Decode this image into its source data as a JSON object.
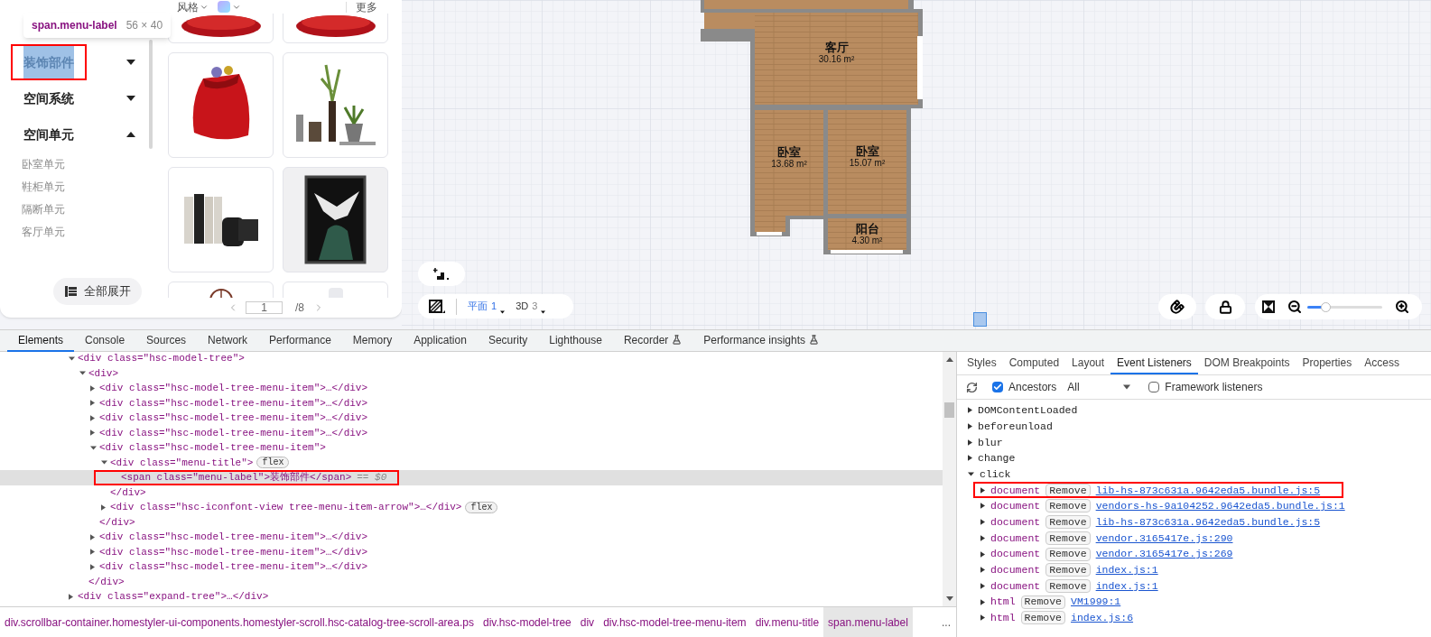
{
  "catalog": {
    "filters": [
      {
        "kind": "text",
        "label": "风格"
      },
      {
        "kind": "swatch"
      }
    ],
    "more": "更多",
    "inspect_tooltip": {
      "selector": "span.menu-label",
      "size": "56 × 40"
    },
    "menu": [
      {
        "label": "装饰部件",
        "selected": true,
        "expanded": false,
        "highlighted": true
      },
      {
        "label": "空间系统",
        "selected": false,
        "expanded": false,
        "highlighted": false
      },
      {
        "label": "空间单元",
        "selected": false,
        "expanded": true,
        "highlighted": false,
        "children": [
          {
            "label": "卧室单元"
          },
          {
            "label": "鞋柜单元"
          },
          {
            "label": "隔断单元"
          },
          {
            "label": "客厅单元"
          }
        ]
      }
    ],
    "expand_all_button": "全部展开",
    "pagination": {
      "page": "1",
      "total": "/8"
    }
  },
  "floor_plan": {
    "rooms": [
      {
        "name": "客厅",
        "area": "30.16 m²"
      },
      {
        "name": "卧室",
        "area": "13.68 m²"
      },
      {
        "name": "卧室",
        "area": "15.07 m²"
      },
      {
        "name": "阳台",
        "area": "4.30 m²"
      }
    ]
  },
  "view_modes": [
    {
      "label": "平面",
      "count": "1",
      "selected": true
    },
    {
      "label": "3D",
      "count": "3",
      "selected": false
    }
  ],
  "zoom": {
    "level": 0.2
  },
  "devtools": {
    "tabs": [
      {
        "label": "Elements",
        "selected": true,
        "experimental": false
      },
      {
        "label": "Console",
        "selected": false,
        "experimental": false
      },
      {
        "label": "Sources",
        "selected": false,
        "experimental": false
      },
      {
        "label": "Network",
        "selected": false,
        "experimental": false
      },
      {
        "label": "Performance",
        "selected": false,
        "experimental": false
      },
      {
        "label": "Memory",
        "selected": false,
        "experimental": false
      },
      {
        "label": "Application",
        "selected": false,
        "experimental": false
      },
      {
        "label": "Security",
        "selected": false,
        "experimental": false
      },
      {
        "label": "Lighthouse",
        "selected": false,
        "experimental": false
      },
      {
        "label": "Recorder",
        "selected": false,
        "experimental": true
      },
      {
        "label": "Performance insights",
        "selected": false,
        "experimental": true
      }
    ],
    "dom_tree": [
      {
        "text": "<div class=\"hsc-model-tree\">",
        "expanded": true,
        "children": [
          {
            "text": "<div>",
            "expanded": true,
            "children": [
              {
                "text": "<div class=\"hsc-model-tree-menu-item\">…</div>",
                "expanded": false
              },
              {
                "text": "<div class=\"hsc-model-tree-menu-item\">…</div>",
                "expanded": false
              },
              {
                "text": "<div class=\"hsc-model-tree-menu-item\">…</div>",
                "expanded": false
              },
              {
                "text": "<div class=\"hsc-model-tree-menu-item\">…</div>",
                "expanded": false
              },
              {
                "text": "<div class=\"hsc-model-tree-menu-item\">",
                "expanded": true,
                "children": [
                  {
                    "text": "<div class=\"menu-title\">",
                    "expanded": true,
                    "badge": "flex",
                    "children": [
                      {
                        "text": "<span class=\"menu-label\">装饰部件</span>",
                        "selected": true,
                        "highlighted": true,
                        "suffix": "== $0"
                      }
                    ]
                  },
                  {
                    "text": "</div>"
                  },
                  {
                    "text": "<div class=\"hsc-iconfont-view tree-menu-item-arrow\">…</div>",
                    "expanded": false,
                    "badge": "flex"
                  }
                ]
              },
              {
                "text": "</div>"
              },
              {
                "text": "<div class=\"hsc-model-tree-menu-item\">…</div>",
                "expanded": false
              },
              {
                "text": "<div class=\"hsc-model-tree-menu-item\">…</div>",
                "expanded": false
              },
              {
                "text": "<div class=\"hsc-model-tree-menu-item\">…</div>",
                "expanded": false
              }
            ]
          },
          {
            "text": "</div>"
          }
        ]
      },
      {
        "text": "<div class=\"expand-tree\">…</div>",
        "expanded": false
      }
    ],
    "breadcrumbs": [
      {
        "label": "div.scrollbar-container.homestyler-ui-components.homestyler-scroll.hsc-catalog-tree-scroll-area.ps",
        "selected": false
      },
      {
        "label": "div.hsc-model-tree",
        "selected": false
      },
      {
        "label": "div",
        "selected": false
      },
      {
        "label": "div.hsc-model-tree-menu-item",
        "selected": false
      },
      {
        "label": "div.menu-title",
        "selected": false
      },
      {
        "label": "span.menu-label",
        "selected": true
      }
    ],
    "breadcrumb_overflow": "...",
    "sidebar_tabs": [
      {
        "label": "Styles",
        "selected": false
      },
      {
        "label": "Computed",
        "selected": false
      },
      {
        "label": "Layout",
        "selected": false
      },
      {
        "label": "Event Listeners",
        "selected": true
      },
      {
        "label": "DOM Breakpoints",
        "selected": false
      },
      {
        "label": "Properties",
        "selected": false
      },
      {
        "label": "Access",
        "selected": false
      }
    ],
    "listener_toolbar": {
      "ancestors": {
        "label": "Ancestors",
        "checked": true
      },
      "filter": "All",
      "framework": {
        "label": "Framework listeners",
        "checked": false
      }
    },
    "listeners": [
      {
        "event": "DOMContentLoaded",
        "expanded": false
      },
      {
        "event": "beforeunload",
        "expanded": false
      },
      {
        "event": "blur",
        "expanded": false
      },
      {
        "event": "change",
        "expanded": false
      },
      {
        "event": "click",
        "expanded": true,
        "children": [
          {
            "target": "document",
            "action": "Remove",
            "source": "lib-hs-873c631a.9642eda5.bundle.js:5",
            "highlighted": true
          },
          {
            "target": "document",
            "action": "Remove",
            "source": "vendors-hs-9a104252.9642eda5.bundle.js:1",
            "highlighted": false
          },
          {
            "target": "document",
            "action": "Remove",
            "source": "lib-hs-873c631a.9642eda5.bundle.js:5",
            "highlighted": false
          },
          {
            "target": "document",
            "action": "Remove",
            "source": "vendor.3165417e.js:290",
            "highlighted": false
          },
          {
            "target": "document",
            "action": "Remove",
            "source": "vendor.3165417e.js:269",
            "highlighted": false
          },
          {
            "target": "document",
            "action": "Remove",
            "source": "index.js:1",
            "highlighted": false
          },
          {
            "target": "document",
            "action": "Remove",
            "source": "index.js:1",
            "highlighted": false
          },
          {
            "target": "html",
            "action": "Remove",
            "source": "VM1999:1",
            "highlighted": false
          },
          {
            "target": "html",
            "action": "Remove",
            "source": "index.js:6",
            "highlighted": false
          }
        ]
      }
    ]
  }
}
